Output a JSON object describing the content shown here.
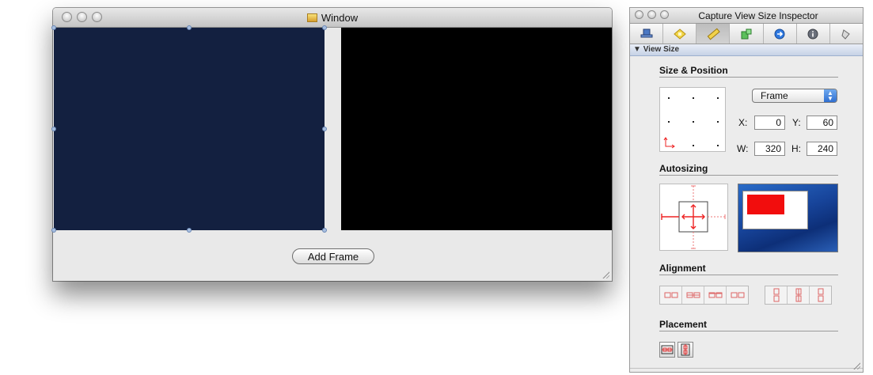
{
  "window": {
    "title": "Window",
    "add_frame_label": "Add Frame"
  },
  "inspector": {
    "title": "Capture View Size Inspector",
    "tabs": [
      "attributes-icon",
      "effects-icon",
      "size-ruler-icon",
      "connections-icon",
      "bindings-icon",
      "identity-icon",
      "applescript-icon"
    ],
    "active_tab": 2,
    "section": "View Size",
    "size_position": {
      "heading": "Size & Position",
      "frame_popup": "Frame",
      "x_label": "X:",
      "x_value": "0",
      "y_label": "Y:",
      "y_value": "60",
      "w_label": "W:",
      "w_value": "320",
      "h_label": "H:",
      "h_value": "240"
    },
    "autosizing_heading": "Autosizing",
    "alignment_heading": "Alignment",
    "placement_heading": "Placement"
  },
  "colors": {
    "view_left": "#132040",
    "view_right": "#000000",
    "autosize_red": "#e21d1d",
    "preview_blue": "#1a4ca6"
  }
}
